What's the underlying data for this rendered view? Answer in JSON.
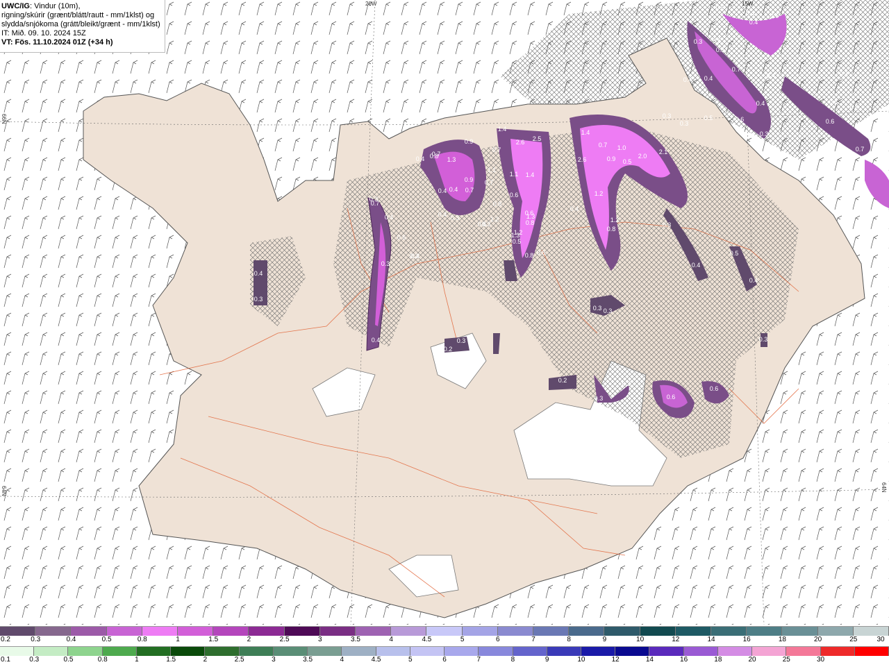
{
  "info": {
    "title_bold": "UWC/IG",
    "title_rest": ": Vindur (10m),",
    "line2": "rigning/skúrir (grænt/blátt/rautt - mm/1klst) og",
    "line3": "slydda/snjókoma (grátt/bleikt/grænt - mm/1klst)",
    "line4": "IT: Mið. 09. 10. 2024 15Z",
    "line5": "VT: Fös. 11.10.2024 01Z (+34 h)"
  },
  "grid_labels": {
    "top_20w": "20W",
    "top_15w": "15W",
    "left_66n": "66N",
    "left_64n": "64N",
    "right_64n": "64N"
  },
  "precip_values": [
    "0.5",
    "0.4",
    "0.6",
    "0.4",
    "0.3",
    "0.5",
    "0.5",
    "0.4",
    "0.4",
    "0.7",
    "0.4",
    "0.4",
    "0.4",
    "0.6",
    "0.6",
    "0.7",
    "0.5",
    "0.3",
    "0.3",
    "0.5",
    "0.6",
    "0.3",
    "0.9",
    "1.4",
    "2.6",
    "2.5",
    "1.4",
    "0.7",
    "1.0",
    "2.0",
    "2.1",
    "0.4",
    "0.7",
    "1.3",
    "0.7",
    "1.1",
    "1.1",
    "0.9",
    "0.7",
    "2.6",
    "0.9",
    "0.5",
    "0.3",
    "0.4",
    "0.4",
    "0.6",
    "1.3",
    "1.3",
    "0.5",
    "0.4",
    "1.2",
    "0.3",
    "0.4",
    "0.8",
    "0.8",
    "1.4",
    "0.6",
    "1.2",
    "0.4",
    "0.6",
    "0.7",
    "0.6",
    "0.8",
    "0.4",
    "0.3",
    "0.3",
    "0.3",
    "0.4",
    "0.4",
    "0.8",
    "1.2",
    "1.2",
    "0.6",
    "0.8",
    "0.7",
    "0.4",
    "0.3",
    "0.4",
    "0.3",
    "0.3",
    "0.3",
    "0.3",
    "0.2",
    "0.2",
    "0.3",
    "0.3",
    "0.6",
    "0.6",
    "0.5",
    "0.3",
    "0.3"
  ],
  "legend_top": {
    "ticks": [
      "0.2",
      "0.3",
      "0.4",
      "0.5",
      "0.8",
      "1",
      "1.5",
      "2",
      "2.5",
      "3",
      "3.5",
      "4",
      "4.5",
      "5",
      "6",
      "7",
      "8",
      "9",
      "10",
      "12",
      "14",
      "16",
      "18",
      "20",
      "25",
      "30"
    ],
    "colors": [
      "#604a6c",
      "#86688e",
      "#9c5aa8",
      "#c864d4",
      "#ee7cf4",
      "#d25fd8",
      "#b446bc",
      "#8c2a94",
      "#4e0a56",
      "#7a2e84",
      "#9e62b2",
      "#b89ad8",
      "#c8c8f8",
      "#a4a4e6",
      "#8a8ad0",
      "#6a78b4",
      "#4a6a8c",
      "#2e5a6a",
      "#124a50",
      "#1e5a64",
      "#3a6e76",
      "#4e7e86",
      "#6a9096",
      "#8ea8ac",
      "#c8d4d4"
    ]
  },
  "legend_bottom": {
    "ticks": [
      "0.1",
      "0.3",
      "0.5",
      "0.8",
      "1",
      "1.5",
      "2",
      "2.5",
      "3",
      "3.5",
      "4",
      "4.5",
      "5",
      "6",
      "7",
      "8",
      "9",
      "10",
      "12",
      "14",
      "16",
      "18",
      "20",
      "25",
      "30"
    ],
    "colors": [
      "#e8fae8",
      "#c4ecc4",
      "#8ed48e",
      "#4eaa4e",
      "#226e22",
      "#0a4a0a",
      "#2e6e2e",
      "#3e7e56",
      "#5a8e76",
      "#7a9e92",
      "#9eb0c4",
      "#b8c0ec",
      "#c4c4f4",
      "#a8a8ec",
      "#8888dc",
      "#6464cc",
      "#3a3ab8",
      "#1a1aa8",
      "#0a0a90",
      "#5a2abc",
      "#9a5ad4",
      "#d48ce4",
      "#f4a4d4",
      "#f47898",
      "#ee2a2a",
      "#ff0000"
    ]
  }
}
